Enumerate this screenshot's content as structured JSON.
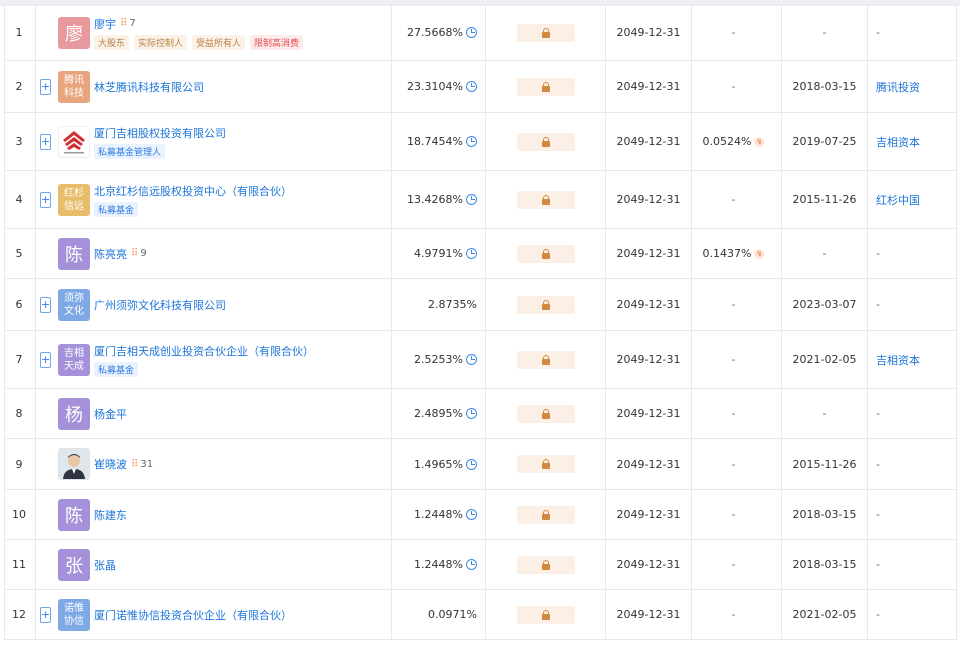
{
  "rows": [
    {
      "index": "1",
      "avatar_text": "廖",
      "avatar_type": "person",
      "avatar_color": "#e8999e",
      "name": "廖宇",
      "relation_count": "7",
      "tags": [
        {
          "text": "大股东",
          "style": "brown"
        },
        {
          "text": "实际控制人",
          "style": "brown"
        },
        {
          "text": "受益所有人",
          "style": "brown"
        },
        {
          "text": "限制高消费",
          "style": "red"
        }
      ],
      "ratio": "27.5668%",
      "ratio_chart": true,
      "date": "2049-12-31",
      "indirect": "-",
      "subscribed_date": "-",
      "link": "-",
      "expandable": false,
      "h": 56
    },
    {
      "index": "2",
      "avatar_text": "腾讯科技",
      "avatar_type": "company",
      "avatar_color": "#e8a47c",
      "name": "林芝腾讯科技有限公司",
      "tags": [],
      "ratio": "23.3104%",
      "ratio_chart": true,
      "date": "2049-12-31",
      "indirect": "-",
      "subscribed_date": "2018-03-15",
      "link": "腾讯投资",
      "expandable": true,
      "h": 52
    },
    {
      "index": "3",
      "avatar_text": "",
      "avatar_type": "logo",
      "avatar_color": "#ffffff",
      "name": "厦门吉相股权投资有限公司",
      "tags": [
        {
          "text": "私募基金管理人",
          "style": "blue"
        }
      ],
      "ratio": "18.7454%",
      "ratio_chart": true,
      "date": "2049-12-31",
      "indirect": "0.0524%",
      "indirect_icon": true,
      "subscribed_date": "2019-07-25",
      "link": "吉相资本",
      "expandable": true,
      "h": 58
    },
    {
      "index": "4",
      "avatar_text": "红杉信远",
      "avatar_type": "company",
      "avatar_color": "#e7bd6b",
      "name": "北京红杉信远股权投资中心（有限合伙）",
      "tags": [
        {
          "text": "私募基金",
          "style": "blue"
        }
      ],
      "ratio": "13.4268%",
      "ratio_chart": true,
      "date": "2049-12-31",
      "indirect": "-",
      "subscribed_date": "2015-11-26",
      "link": "红杉中国",
      "expandable": true,
      "h": 58
    },
    {
      "index": "5",
      "avatar_text": "陈",
      "avatar_type": "person",
      "avatar_color": "#a591d9",
      "name": "陈亮亮",
      "relation_count": "9",
      "tags": [],
      "ratio": "4.9791%",
      "ratio_chart": true,
      "date": "2049-12-31",
      "indirect": "0.1437%",
      "indirect_icon": true,
      "subscribed_date": "-",
      "link": "-",
      "expandable": false,
      "h": 50
    },
    {
      "index": "6",
      "avatar_text": "须弥文化",
      "avatar_type": "company",
      "avatar_color": "#7fa9e5",
      "name": "广州须弥文化科技有限公司",
      "tags": [],
      "ratio": "2.8735%",
      "ratio_chart": false,
      "date": "2049-12-31",
      "indirect": "-",
      "subscribed_date": "2023-03-07",
      "link": "-",
      "expandable": true,
      "h": 52
    },
    {
      "index": "7",
      "avatar_text": "吉相天成",
      "avatar_type": "company",
      "avatar_color": "#a591d9",
      "name": "厦门吉相天成创业投资合伙企业（有限合伙）",
      "tags": [
        {
          "text": "私募基金",
          "style": "blue"
        }
      ],
      "ratio": "2.5253%",
      "ratio_chart": true,
      "date": "2049-12-31",
      "indirect": "-",
      "subscribed_date": "2021-02-05",
      "link": "吉相资本",
      "expandable": true,
      "h": 58
    },
    {
      "index": "8",
      "avatar_text": "杨",
      "avatar_type": "person",
      "avatar_color": "#a591d9",
      "name": "杨金平",
      "tags": [],
      "ratio": "2.4895%",
      "ratio_chart": true,
      "date": "2049-12-31",
      "indirect": "-",
      "subscribed_date": "-",
      "link": "-",
      "expandable": false,
      "h": 50
    },
    {
      "index": "9",
      "avatar_text": "",
      "avatar_type": "photo",
      "avatar_color": "#f2f2f2",
      "name": "崔晓波",
      "relation_count": "31",
      "tags": [],
      "ratio": "1.4965%",
      "ratio_chart": true,
      "date": "2049-12-31",
      "indirect": "-",
      "subscribed_date": "2015-11-26",
      "link": "-",
      "expandable": false,
      "h": 51
    },
    {
      "index": "10",
      "avatar_text": "陈",
      "avatar_type": "person",
      "avatar_color": "#a591d9",
      "name": "陈建东",
      "tags": [],
      "ratio": "1.2448%",
      "ratio_chart": true,
      "date": "2049-12-31",
      "indirect": "-",
      "subscribed_date": "2018-03-15",
      "link": "-",
      "expandable": false,
      "h": 50
    },
    {
      "index": "11",
      "avatar_text": "张",
      "avatar_type": "person",
      "avatar_color": "#a591d9",
      "name": "张晶",
      "tags": [],
      "ratio": "1.2448%",
      "ratio_chart": true,
      "date": "2049-12-31",
      "indirect": "-",
      "subscribed_date": "2018-03-15",
      "link": "-",
      "expandable": false,
      "h": 50
    },
    {
      "index": "12",
      "avatar_text": "诺惟协信",
      "avatar_type": "company",
      "avatar_color": "#7fa9e5",
      "name": "厦门诺惟协信投资合伙企业（有限合伙）",
      "tags": [],
      "ratio": "0.0971%",
      "ratio_chart": false,
      "date": "2049-12-31",
      "indirect": "-",
      "subscribed_date": "2021-02-05",
      "link": "-",
      "expandable": true,
      "h": 50
    }
  ],
  "icons": {
    "relation": "relation-graph-icon",
    "ratio_chart": "equity-chart-icon",
    "lock": "lock-icon",
    "indirect": "indirect-path-icon",
    "expand": "plus-icon"
  },
  "colors": {
    "link_blue": "#1b74d9",
    "lock_orange": "#d1893f",
    "lock_bg": "#fcefe5",
    "border": "#e6e9ef"
  },
  "expand_symbol": "+",
  "relation_symbol": "⠿",
  "indirect_symbol": "↯"
}
